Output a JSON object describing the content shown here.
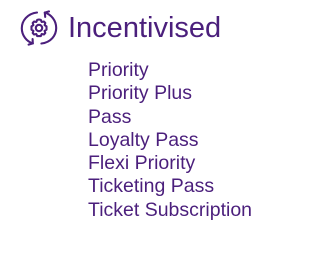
{
  "colors": {
    "accent": "#4b1f7c"
  },
  "group": {
    "icon": "rotating-gear-icon",
    "title": "Incentivised",
    "items": [
      {
        "label": "Priority"
      },
      {
        "label": "Priority Plus"
      },
      {
        "label": "Pass"
      },
      {
        "label": "Loyalty Pass"
      },
      {
        "label": "Flexi Priority"
      },
      {
        "label": "Ticketing Pass"
      },
      {
        "label": "Ticket Subscription"
      }
    ]
  }
}
